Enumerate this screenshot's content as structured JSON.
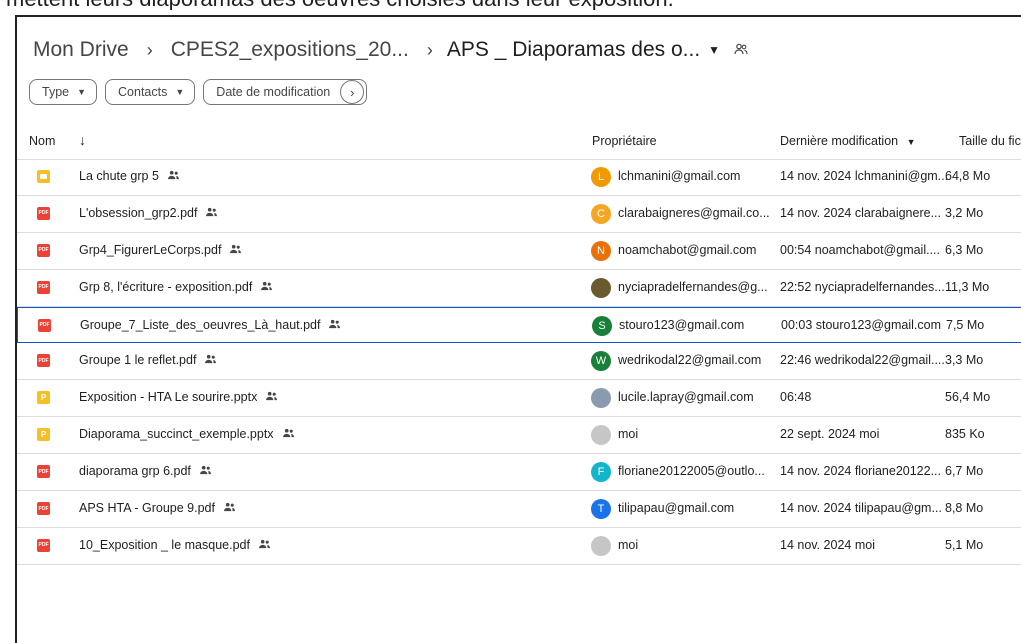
{
  "caption": "mettent leurs diaporamas des oeuvres choisies dans leur exposition.",
  "breadcrumb": {
    "root": "Mon Drive",
    "parent": "CPES2_expositions_20...",
    "current": "APS _ Diaporamas des o...",
    "separator": "›"
  },
  "filters": {
    "type": "Type",
    "contacts": "Contacts",
    "modified": "Date de modification"
  },
  "columns": {
    "name": "Nom",
    "owner": "Propriétaire",
    "modified": "Dernière modification",
    "size": "Taille du fic"
  },
  "rows": [
    {
      "name": "La chute grp 5",
      "icon": "slides-icon",
      "avatar": "L",
      "avatar_color": "#f29900",
      "owner": "lchmanini@gmail.com",
      "modified": "14 nov. 2024 lchmanini@gm...",
      "size": "64,8 Mo"
    },
    {
      "name": "L'obsession_grp2.pdf",
      "icon": "pdf-icon",
      "avatar": "C",
      "avatar_color": "#f6a623",
      "owner": "clarabaigneres@gmail.co...",
      "modified": "14 nov. 2024 clarabaignere...",
      "size": "3,2 Mo"
    },
    {
      "name": "Grp4_FigurerLeCorps.pdf",
      "icon": "pdf-icon",
      "avatar": "N",
      "avatar_color": "#e8710a",
      "owner": "noamchabot@gmail.com",
      "modified": "00:54 noamchabot@gmail....",
      "size": "6,3 Mo"
    },
    {
      "name": "Grp 8, l'écriture - exposition.pdf",
      "icon": "pdf-icon",
      "avatar": "",
      "avatar_color": "#6b5a2e",
      "owner": "nyciapradelfernandes@g...",
      "modified": "22:52 nyciapradelfernandes...",
      "size": "11,3 Mo"
    },
    {
      "name": "Groupe_7_Liste_des_oeuvres_Là_haut.pdf",
      "icon": "pdf-icon",
      "avatar": "S",
      "avatar_color": "#188038",
      "owner": "stouro123@gmail.com",
      "modified": "00:03 stouro123@gmail.com",
      "size": "7,5 Mo"
    },
    {
      "name": "Groupe 1 le reflet.pdf",
      "icon": "pdf-icon",
      "avatar": "W",
      "avatar_color": "#188038",
      "owner": "wedrikodal22@gmail.com",
      "modified": "22:46 wedrikodal22@gmail....",
      "size": "3,3 Mo"
    },
    {
      "name": "Exposition - HTA Le sourire.pptx",
      "icon": "pptx-icon",
      "avatar": "",
      "avatar_color": "#8a9bb0",
      "owner": "lucile.lapray@gmail.com",
      "modified": "06:48",
      "size": "56,4 Mo"
    },
    {
      "name": "Diaporama_succinct_exemple.pptx",
      "icon": "pptx-icon",
      "avatar": "",
      "avatar_color": "#c4c7c5",
      "owner": "moi",
      "modified": "22 sept. 2024 moi",
      "size": "835 Ko"
    },
    {
      "name": "diaporama grp 6.pdf",
      "icon": "pdf-icon",
      "avatar": "F",
      "avatar_color": "#12b5cb",
      "owner": "floriane20122005@outlo...",
      "modified": "14 nov. 2024 floriane20122...",
      "size": "6,7 Mo"
    },
    {
      "name": "APS HTA - Groupe 9.pdf",
      "icon": "pdf-icon",
      "avatar": "T",
      "avatar_color": "#1a73e8",
      "owner": "tilipapau@gmail.com",
      "modified": "14 nov. 2024 tilipapau@gm...",
      "size": "8,8 Mo"
    },
    {
      "name": "10_Exposition _ le masque.pdf",
      "icon": "pdf-icon",
      "avatar": "",
      "avatar_color": "#c4c7c5",
      "owner": "moi",
      "modified": "14 nov. 2024 moi",
      "size": "5,1 Mo"
    }
  ],
  "selected_index": 4,
  "icon_labels": {
    "pdf": "PDF",
    "pptx": "P"
  }
}
